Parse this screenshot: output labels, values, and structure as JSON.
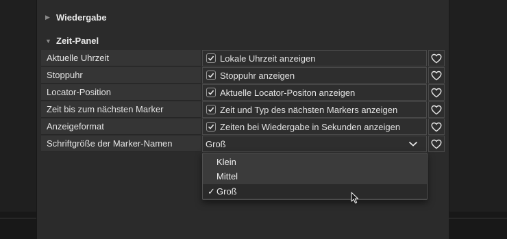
{
  "sections": {
    "playback": {
      "label": "Wiedergabe",
      "expanded": false
    },
    "time_panel": {
      "label": "Zeit-Panel",
      "expanded": true
    }
  },
  "rows": [
    {
      "label": "Aktuelle Uhrzeit",
      "checked": true,
      "value": "Lokale Uhrzeit anzeigen",
      "favorite_icon": "heart-outline-icon"
    },
    {
      "label": "Stoppuhr",
      "checked": true,
      "value": "Stoppuhr anzeigen",
      "favorite_icon": "heart-outline-icon"
    },
    {
      "label": "Locator-Position",
      "checked": true,
      "value": "Aktuelle Locator-Positon anzeigen",
      "favorite_icon": "heart-outline-icon"
    },
    {
      "label": "Zeit bis zum nächsten Marker",
      "checked": true,
      "value": "Zeit und Typ des nächsten Markers anzeigen",
      "favorite_icon": "heart-outline-icon"
    },
    {
      "label": "Anzeigeformat",
      "checked": true,
      "value": "Zeiten bei Wiedergabe in Sekunden anzeigen",
      "favorite_icon": "heart-outline-icon"
    }
  ],
  "font_size_row": {
    "label": "Schriftgröße der Marker-Namen",
    "selected": "Groß",
    "favorite_icon": "heart-outline-icon"
  },
  "dropdown": {
    "options": [
      "Klein",
      "Mittel",
      "Groß"
    ],
    "selected_index": 2,
    "check_mark": "✓"
  },
  "colors": {
    "background": "#1f1f1f",
    "panel": "#2b2b2b",
    "label_cell": "#353535",
    "value_cell": "#2e2e2e",
    "dropdown": "#3b3b3b",
    "text": "#e4e4e4"
  }
}
